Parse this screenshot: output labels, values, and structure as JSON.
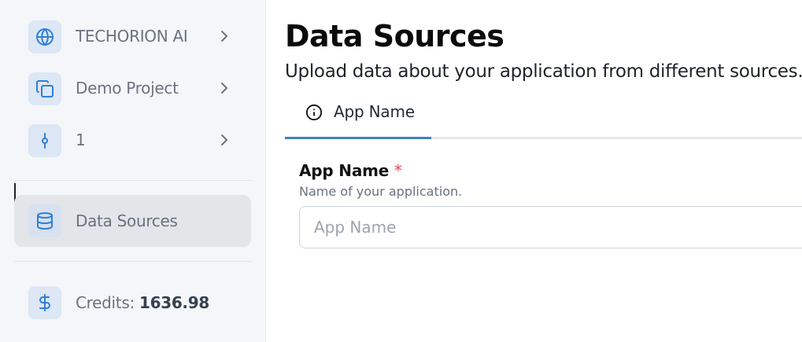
{
  "sidebar": {
    "items": [
      {
        "label": "TECHORION AI",
        "icon": "globe-icon"
      },
      {
        "label": "Demo Project",
        "icon": "copy-icon"
      },
      {
        "label": "1",
        "icon": "git-commit-icon"
      }
    ],
    "active_item": {
      "label": "Data Sources",
      "icon": "database-icon"
    },
    "credits": {
      "label": "Credits: ",
      "value": "1636.98",
      "icon": "dollar-icon"
    }
  },
  "main": {
    "title": "Data Sources",
    "subtitle": "Upload data about your application from different sources.",
    "tabs": [
      {
        "label": "App Name",
        "icon": "info-icon"
      }
    ],
    "form": {
      "label": "App Name",
      "required_mark": "*",
      "help": "Name of your application.",
      "placeholder": "App Name",
      "value": ""
    }
  },
  "colors": {
    "accent": "#3b82c8",
    "icon_blue": "#2f7fd6",
    "icon_bg": "#dde7f5",
    "required": "#e5484d"
  }
}
